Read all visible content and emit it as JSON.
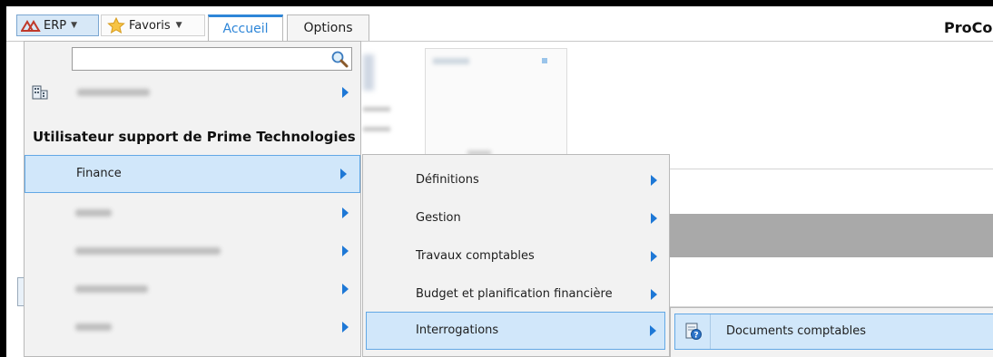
{
  "toolbar": {
    "erp_label": "ERP",
    "favorites_label": "Favoris",
    "tabs": [
      {
        "label": "Accueil",
        "active": true
      },
      {
        "label": "Options",
        "active": false
      }
    ],
    "app_title": "ProCo"
  },
  "erp_menu": {
    "search": {
      "value": "",
      "placeholder": ""
    },
    "user_label": "Utilisateur support de Prime Technologies",
    "items": [
      {
        "label": "Finance",
        "active": true
      }
    ]
  },
  "finance_menu": {
    "items": [
      {
        "label": "Définitions"
      },
      {
        "label": "Gestion"
      },
      {
        "label": "Travaux comptables"
      },
      {
        "label": "Budget et planification financière"
      },
      {
        "label": "Interrogations",
        "active": true
      }
    ]
  },
  "interrogations_menu": {
    "items": [
      {
        "label": "Documents comptables",
        "icon": "document-info-icon",
        "active": true
      }
    ]
  },
  "colors": {
    "accent": "#2e86d8",
    "highlight_bg": "#d1e7fa",
    "highlight_border": "#62a8e5",
    "arrow": "#1e78d6"
  }
}
